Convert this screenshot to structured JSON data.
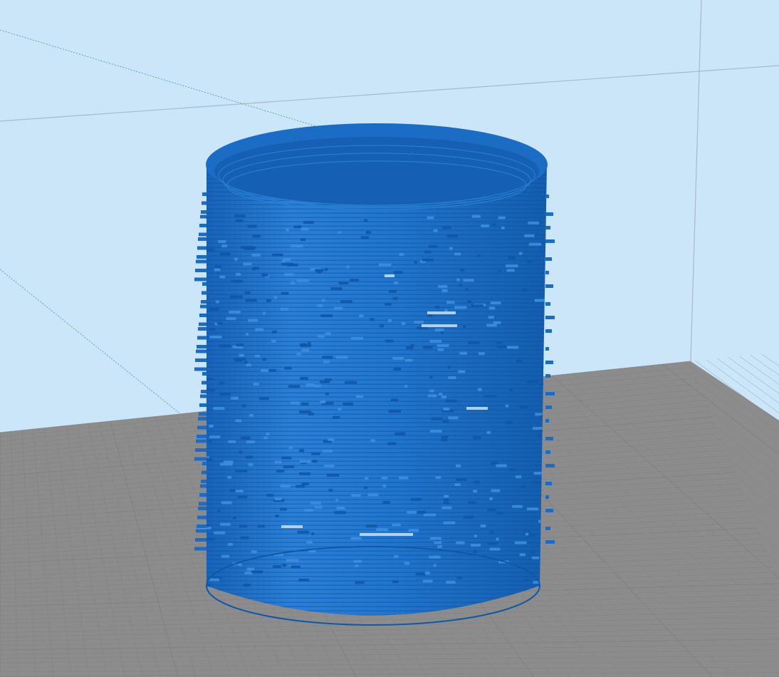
{
  "viewport": {
    "background_color": "#cbe6f9",
    "build_plate_color": "#8c8c8c",
    "grid_line_color": "#7d7d7d",
    "model_color": "#1f6fc5",
    "model_highlight_color": "#3b8ee0",
    "model_shadow_color": "#0f57a8"
  },
  "model": {
    "shape": "cylinder",
    "description_visible": false
  }
}
